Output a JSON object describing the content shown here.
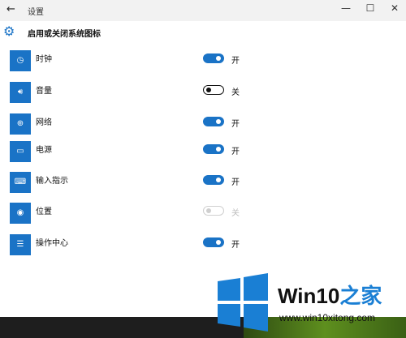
{
  "window": {
    "title": "设置",
    "back_icon": "←",
    "minimize": "—",
    "maximize": "☐",
    "close": "✕"
  },
  "page": {
    "heading": "启用或关闭系统图标"
  },
  "items": [
    {
      "label": "时钟",
      "icon": "clock-icon",
      "glyph": "◷",
      "state": "开",
      "on": true,
      "enabled": true
    },
    {
      "label": "音量",
      "icon": "volume-icon",
      "glyph": "🔊︎",
      "state": "关",
      "on": false,
      "enabled": true
    },
    {
      "label": "网络",
      "icon": "network-icon",
      "glyph": "⊕",
      "state": "开",
      "on": true,
      "enabled": true
    },
    {
      "label": "电源",
      "icon": "battery-icon",
      "glyph": "▭",
      "state": "开",
      "on": true,
      "enabled": true
    },
    {
      "label": "输入指示",
      "icon": "keyboard-icon",
      "glyph": "⌨",
      "state": "开",
      "on": true,
      "enabled": true
    },
    {
      "label": "位置",
      "icon": "location-icon",
      "glyph": "◉",
      "state": "关",
      "on": false,
      "enabled": false
    },
    {
      "label": "操作中心",
      "icon": "action-center-icon",
      "glyph": "☰",
      "state": "开",
      "on": true,
      "enabled": true
    }
  ],
  "watermark": {
    "brand": "Win10",
    "brand_suffix": "之家",
    "url": "www.win10xitong.com"
  },
  "colors": {
    "accent": "#1a73c6",
    "logo": "#1a7fd4"
  }
}
